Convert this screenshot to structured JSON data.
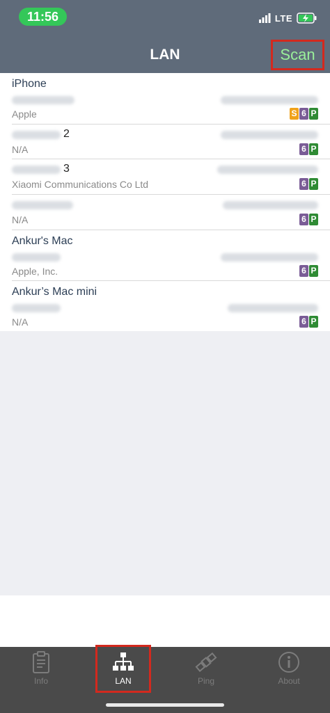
{
  "status_bar": {
    "time": "11:56",
    "network": "LTE"
  },
  "nav": {
    "title": "LAN",
    "scan_label": "Scan"
  },
  "devices": [
    {
      "name": "iPhone",
      "vendor": "Apple",
      "badges": [
        "S",
        "6",
        "P"
      ]
    },
    {
      "name": "2",
      "vendor": "N/A",
      "badges": [
        "6",
        "P"
      ]
    },
    {
      "name": "3",
      "vendor": "Xiaomi Communications Co Ltd",
      "badges": [
        "6",
        "P"
      ]
    },
    {
      "name": "",
      "vendor": "N/A",
      "badges": [
        "6",
        "P"
      ]
    },
    {
      "name": "Ankur's Mac",
      "vendor": "Apple, Inc.",
      "badges": [
        "6",
        "P"
      ]
    },
    {
      "name": "Ankur’s Mac mini",
      "vendor": "N/A",
      "badges": [
        "6",
        "P"
      ]
    }
  ],
  "tabs": [
    {
      "label": "Info",
      "icon": "clipboard-icon"
    },
    {
      "label": "LAN",
      "icon": "network-icon"
    },
    {
      "label": "Ping",
      "icon": "satellite-icon"
    },
    {
      "label": "About",
      "icon": "info-icon"
    }
  ],
  "colors": {
    "header": "#5f6b7a",
    "accent_highlight": "#d3291e",
    "scan_text": "#9af09a",
    "badge_s": "#f0a21a",
    "badge_6": "#7a5c96",
    "badge_p": "#2f8b34"
  }
}
